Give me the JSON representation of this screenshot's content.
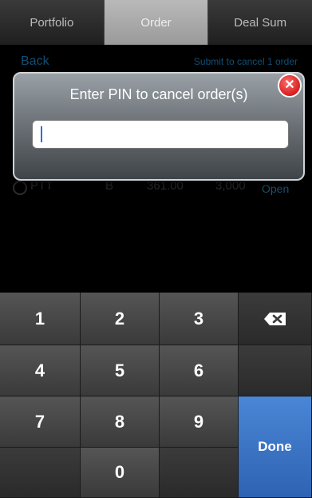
{
  "tabs": [
    {
      "label": "Portfolio",
      "active": false
    },
    {
      "label": "Order",
      "active": true
    },
    {
      "label": "Deal Sum",
      "active": false
    }
  ],
  "order_screen": {
    "back_label": "Back",
    "submit_label": "Submit to cancel 1 order",
    "rows": [
      {
        "symbol": "PTT",
        "side": "B",
        "price": "361.00",
        "volume": "3,000",
        "status": "Open"
      }
    ]
  },
  "dialog": {
    "title": "Enter PIN to cancel order(s)",
    "pin_value": "",
    "close_icon": "close-icon"
  },
  "keypad": {
    "keys": [
      "1",
      "2",
      "3",
      "4",
      "5",
      "6",
      "7",
      "8",
      "9",
      "0"
    ],
    "done_label": "Done",
    "backspace_icon": "backspace-icon"
  },
  "colors": {
    "accent_blue": "#1e90d6",
    "done_blue": "#3a74c6",
    "close_red": "#d60000"
  }
}
